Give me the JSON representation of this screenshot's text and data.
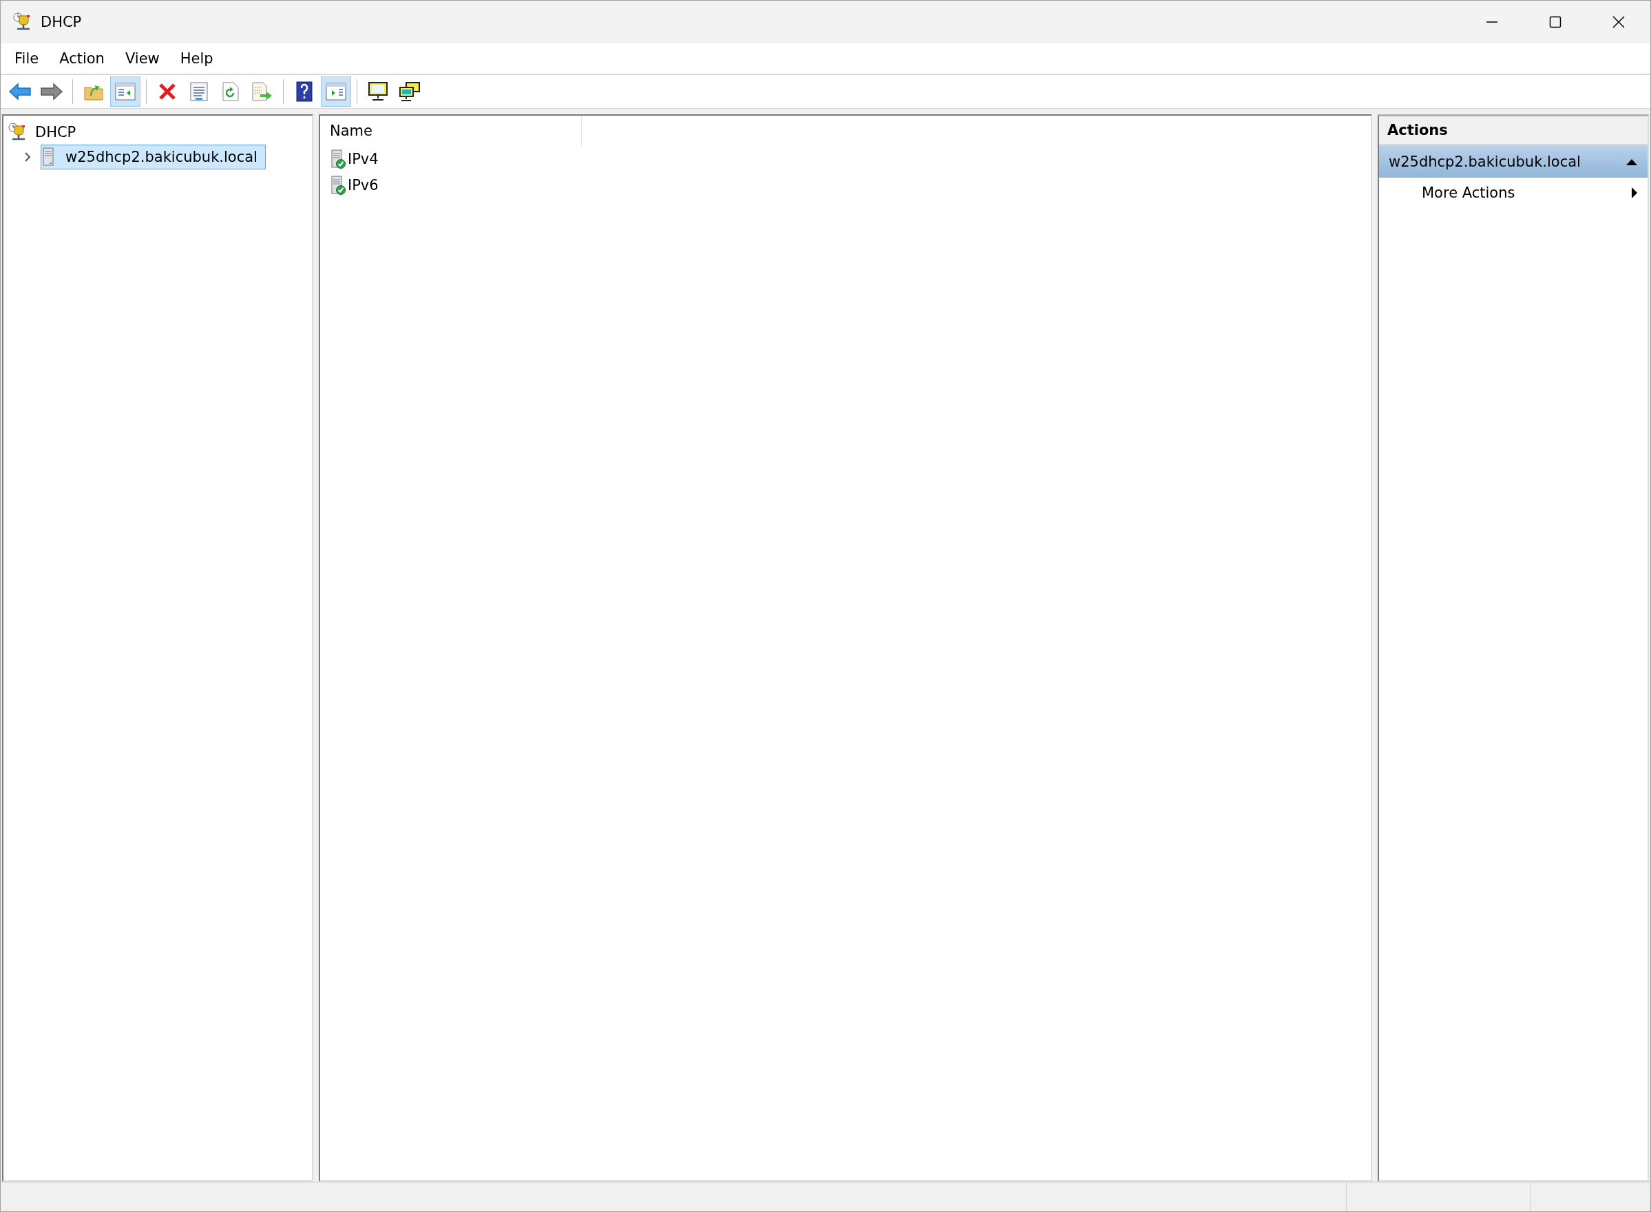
{
  "window": {
    "title": "DHCP"
  },
  "menu": [
    "File",
    "Action",
    "View",
    "Help"
  ],
  "toolbar": [
    {
      "kind": "back",
      "pressed": false
    },
    {
      "kind": "forward",
      "pressed": false
    },
    {
      "kind": "separator"
    },
    {
      "kind": "up",
      "pressed": false
    },
    {
      "kind": "tree-toggle",
      "pressed": true
    },
    {
      "kind": "separator"
    },
    {
      "kind": "delete",
      "pressed": false
    },
    {
      "kind": "properties",
      "pressed": false
    },
    {
      "kind": "refresh",
      "pressed": false
    },
    {
      "kind": "export",
      "pressed": false
    },
    {
      "kind": "separator"
    },
    {
      "kind": "help",
      "pressed": false
    },
    {
      "kind": "action-toggle",
      "pressed": true
    },
    {
      "kind": "separator"
    },
    {
      "kind": "monitor",
      "pressed": false
    },
    {
      "kind": "monitors",
      "pressed": false
    }
  ],
  "tree": [
    {
      "label": "DHCP",
      "kind": "root",
      "selected": false,
      "children": [
        {
          "label": "w25dhcp2.bakicubuk.local",
          "kind": "server",
          "expanded": false,
          "selected": true
        }
      ]
    }
  ],
  "list": {
    "columns": [
      "Name"
    ],
    "rows": [
      {
        "name": "IPv4"
      },
      {
        "name": "IPv6"
      }
    ]
  },
  "actions": {
    "title": "Actions",
    "sections": [
      {
        "title": "w25dhcp2.bakicubuk.local",
        "expanded": true,
        "items": [
          {
            "label": "More Actions",
            "kind": "submenu"
          }
        ]
      }
    ]
  }
}
